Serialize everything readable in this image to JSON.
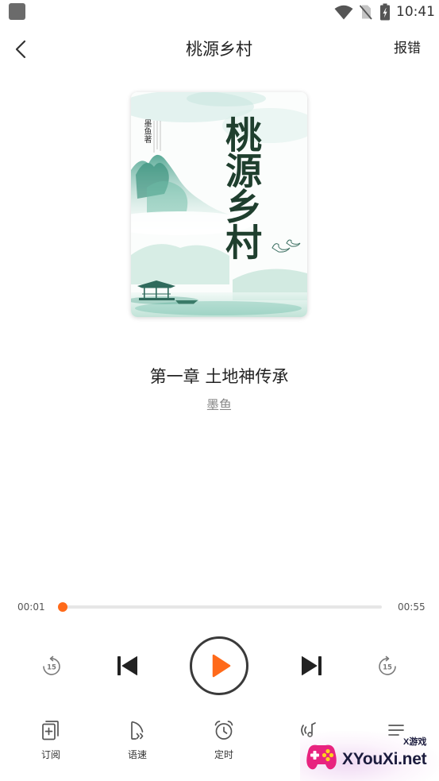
{
  "status_bar": {
    "time": "10:41",
    "icons": [
      "app-notification-icon",
      "wifi-icon",
      "no-sim-icon",
      "battery-charging-icon"
    ]
  },
  "header": {
    "back_icon": "chevron-left-icon",
    "title": "桃源乡村",
    "report_label": "报错"
  },
  "cover": {
    "title": "桃源乡村",
    "author_credit": "墨鱼著"
  },
  "track": {
    "chapter_title": "第一章 土地神传承",
    "author": "墨鱼"
  },
  "progress": {
    "elapsed": "00:01",
    "total": "00:55",
    "fraction": 0.01
  },
  "controls": {
    "rewind": {
      "icon": "rewind-15-icon",
      "seconds": "15"
    },
    "previous": {
      "icon": "skip-previous-icon"
    },
    "play": {
      "icon": "play-icon"
    },
    "next": {
      "icon": "skip-next-icon"
    },
    "forward": {
      "icon": "forward-15-icon",
      "seconds": "15"
    }
  },
  "toolbar": {
    "items": [
      {
        "label": "订阅",
        "icon": "subscribe-icon"
      },
      {
        "label": "语速",
        "icon": "speed-icon"
      },
      {
        "label": "定时",
        "icon": "timer-icon"
      },
      {
        "icon": "sound-effect-icon"
      },
      {
        "icon": "playlist-icon"
      }
    ]
  },
  "watermark": {
    "logo_icon": "gamepad-logo-icon",
    "tag": "X游戏",
    "brand": "XYouXi.net"
  },
  "colors": {
    "accent": "#FF6A1A",
    "text_primary": "#222222",
    "text_secondary": "#888888",
    "track": "#E6E6E6"
  }
}
